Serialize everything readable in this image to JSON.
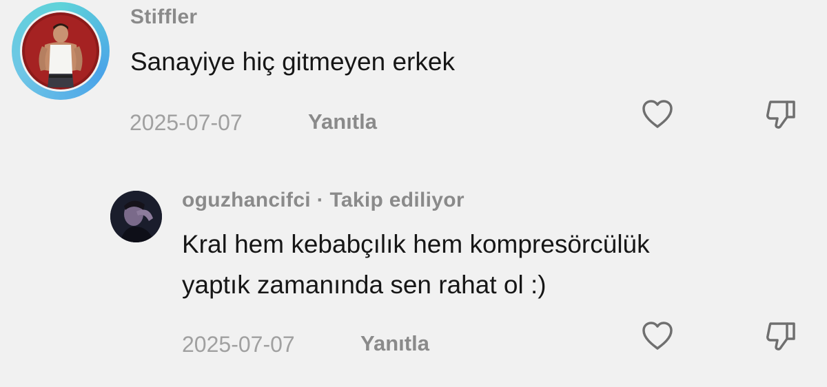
{
  "comments": [
    {
      "username": "Stiffler",
      "text": "Sanayiye hiç gitmeyen erkek",
      "date": "2025-07-07",
      "reply_label": "Yanıtla"
    },
    {
      "username": "oguzhancifci",
      "separator": "·",
      "follow_status": "Takip ediliyor",
      "text_lines": [
        "Kral hem kebabçılık hem kompresörcülük",
        "yaptık zamanında sen rahat ol :)"
      ],
      "date": "2025-07-07",
      "reply_label": "Yanıtla"
    }
  ],
  "icons": {
    "like": "heart-outline-icon",
    "dislike": "thumbs-down-outline-icon"
  },
  "colors": {
    "background": "#f1f1f1",
    "story_ring_start": "#5fd3d9",
    "story_ring_end": "#4aa3e8",
    "text_primary": "#161616",
    "text_secondary": "#8a8a8a",
    "date": "#a0a0a0",
    "icon": "#6f6f6f"
  }
}
